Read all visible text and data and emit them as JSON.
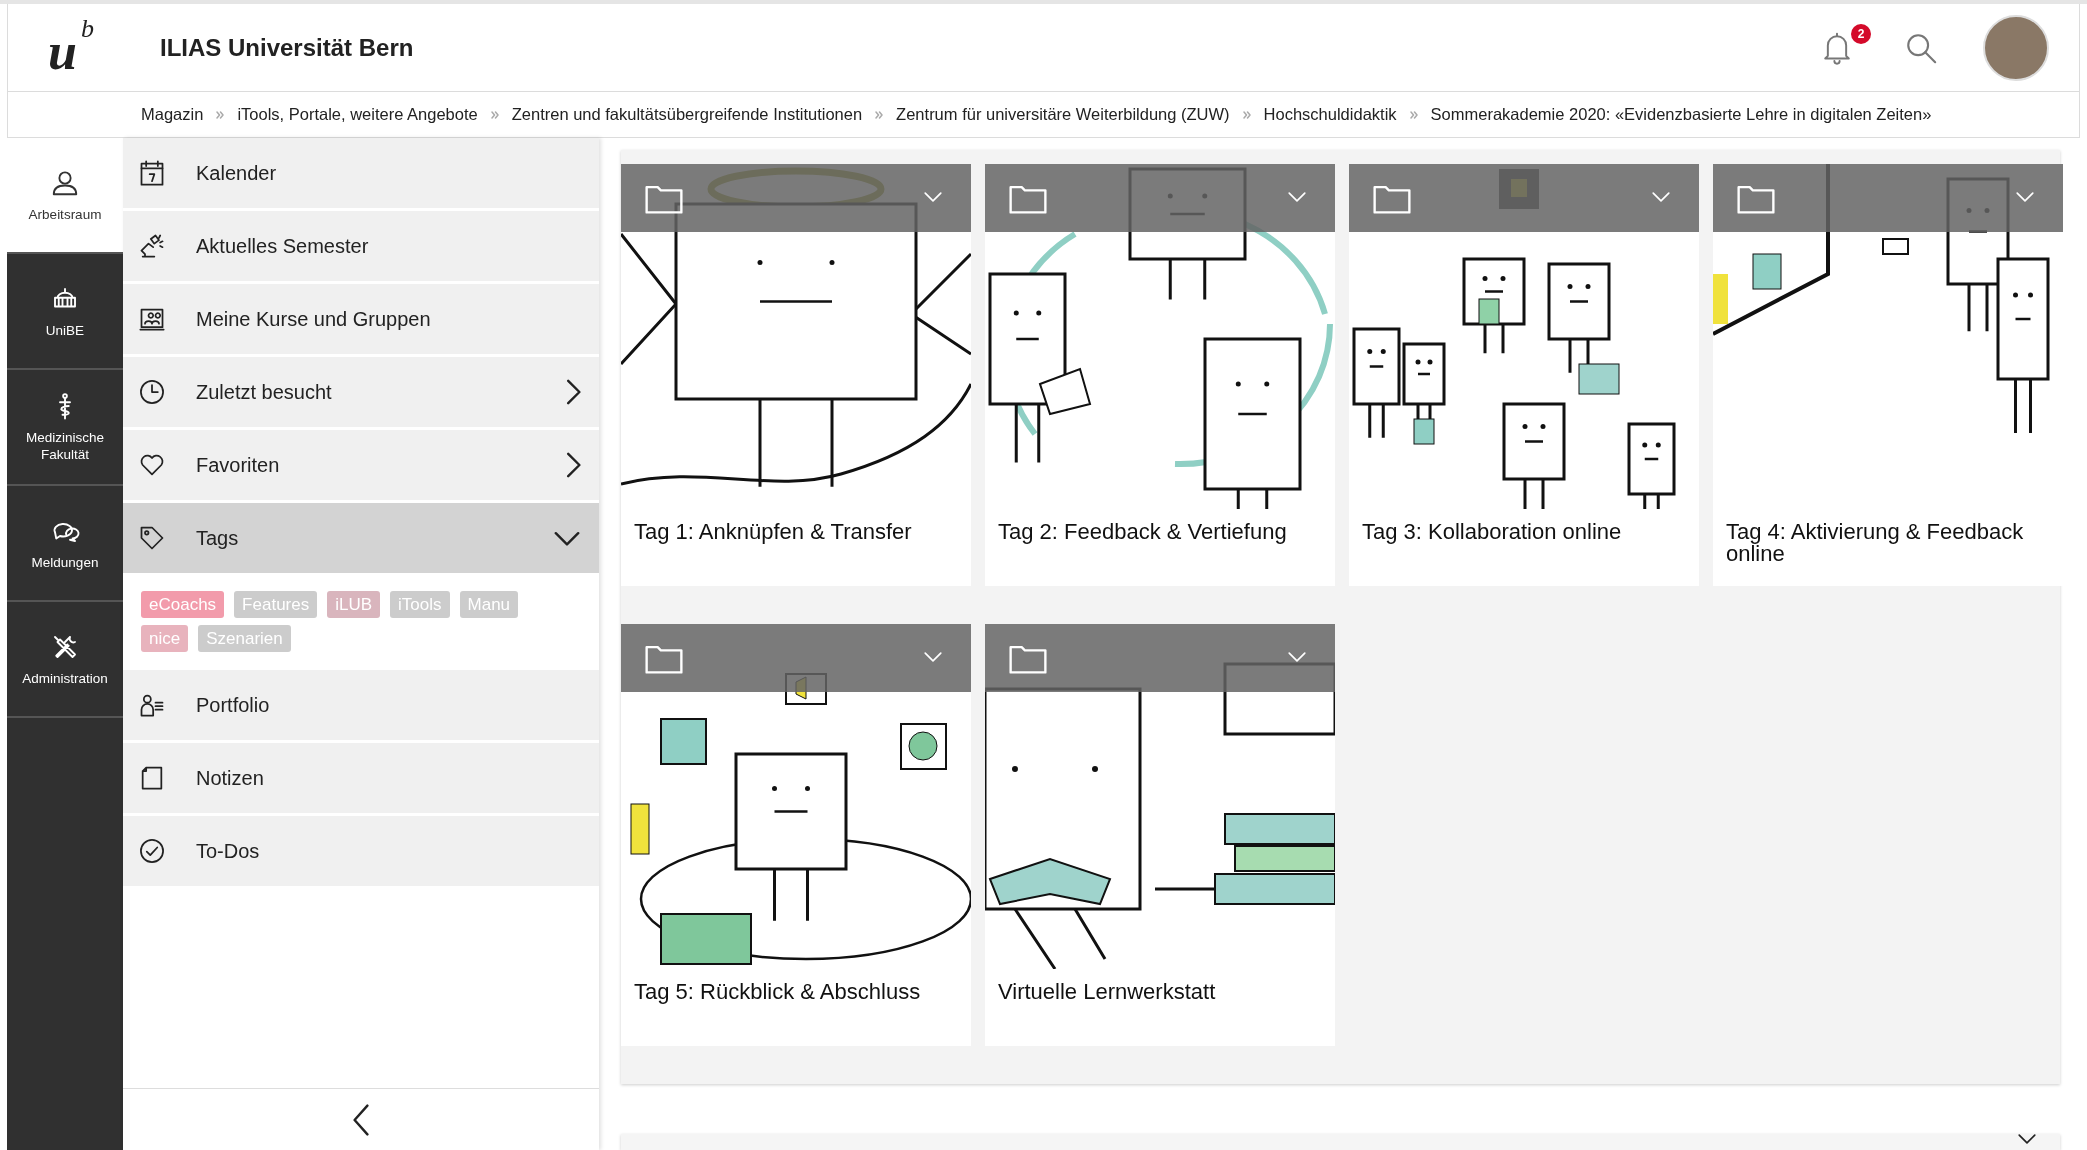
{
  "header": {
    "logo": {
      "letter": "u",
      "superscript": "b"
    },
    "title": "ILIAS Universität Bern",
    "notification_count": "2"
  },
  "breadcrumbs": [
    "Magazin",
    "iTools, Portale, weitere Angebote",
    "Zentren und fakultätsübergreifende Institutionen",
    "Zentrum für universitäre Weiterbildung (ZUW)",
    "Hochschuldidaktik",
    "Sommerakademie 2020: «Evidenzbasierte Lehre in digitalen Zeiten»"
  ],
  "mainbar": [
    {
      "label": "Arbeitsraum",
      "selected": true
    },
    {
      "label": "UniBE",
      "selected": false
    },
    {
      "label": "Medizinische Fakultät",
      "selected": false
    },
    {
      "label": "Meldungen",
      "selected": false
    },
    {
      "label": "Administration",
      "selected": false
    }
  ],
  "slate": {
    "items": [
      {
        "label": "Kalender",
        "kind": "link"
      },
      {
        "label": "Aktuelles Semester",
        "kind": "link"
      },
      {
        "label": "Meine Kurse und Gruppen",
        "kind": "link"
      },
      {
        "label": "Zuletzt besucht",
        "kind": "submenu"
      },
      {
        "label": "Favoriten",
        "kind": "submenu"
      },
      {
        "label": "Tags",
        "kind": "expandable",
        "expanded": true,
        "tags": [
          {
            "label": "eCoachs",
            "color": "#f29bab"
          },
          {
            "label": "Features",
            "color": "#cccccc"
          },
          {
            "label": "iLUB",
            "color": "#d9b5bd"
          },
          {
            "label": "iTools",
            "color": "#cccccc"
          },
          {
            "label": "Manu",
            "color": "#cccccc"
          },
          {
            "label": "nice",
            "color": "#e8b3bd"
          },
          {
            "label": "Szenarien",
            "color": "#cccccc"
          }
        ]
      },
      {
        "label": "Portfolio",
        "kind": "link"
      },
      {
        "label": "Notizen",
        "kind": "link"
      },
      {
        "label": "To-Dos",
        "kind": "link"
      }
    ]
  },
  "tiles": [
    {
      "title": "Tag 1: Anknüpfen & Transfer"
    },
    {
      "title": "Tag 2: Feedback & Vertiefung"
    },
    {
      "title": "Tag 3: Kollaboration online"
    },
    {
      "title": "Tag 4: Aktivierung & Feedback online"
    },
    {
      "title": "Tag 5: Rückblick & Abschluss"
    },
    {
      "title": "Virtuelle Lernwerkstatt"
    }
  ]
}
